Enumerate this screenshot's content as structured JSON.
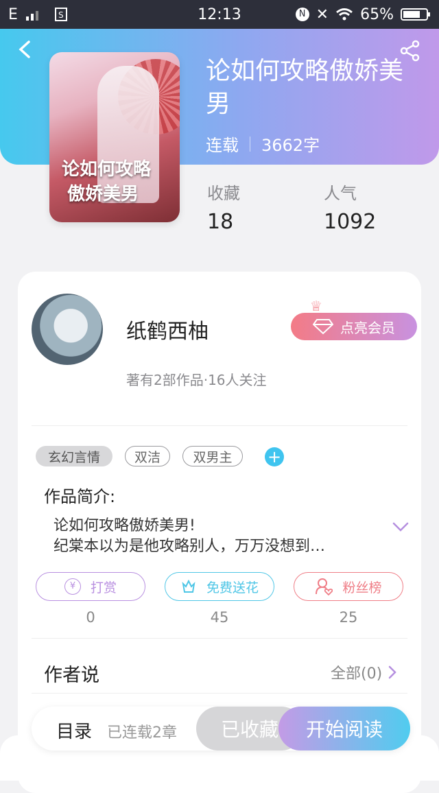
{
  "status_bar": {
    "network": "E",
    "time": "12:13",
    "battery": "65%"
  },
  "book": {
    "title": "论如何攻略傲娇美男",
    "status": "连载",
    "word_count": "3662字",
    "cover_title_line1": "论如何攻略",
    "cover_title_line2": "傲娇美男"
  },
  "stats": {
    "favorites_label": "收藏",
    "favorites_value": "18",
    "popularity_label": "人气",
    "popularity_value": "1092"
  },
  "author": {
    "name": "纸鹤西柚",
    "subtitle": "著有2部作品·16人关注",
    "vip_button": "点亮会员"
  },
  "tags": [
    "玄幻言情",
    "双洁",
    "双男主"
  ],
  "intro": {
    "label": "作品简介:",
    "line1": "论如何攻略傲娇美男!",
    "line2": "纪棠本以为是他攻略别人，万万没想到…"
  },
  "actions": [
    {
      "label": "打赏",
      "count": "0",
      "color": "#b88fe0"
    },
    {
      "label": "免费送花",
      "count": "45",
      "color": "#4fc6e6"
    },
    {
      "label": "粉丝榜",
      "count": "25",
      "color": "#ef7d86"
    }
  ],
  "author_says": {
    "label": "作者说",
    "all": "全部(0)"
  },
  "bottom": {
    "toc": "目录",
    "chapters": "已连载2章",
    "favorited": "已收藏",
    "read": "开始阅读"
  }
}
